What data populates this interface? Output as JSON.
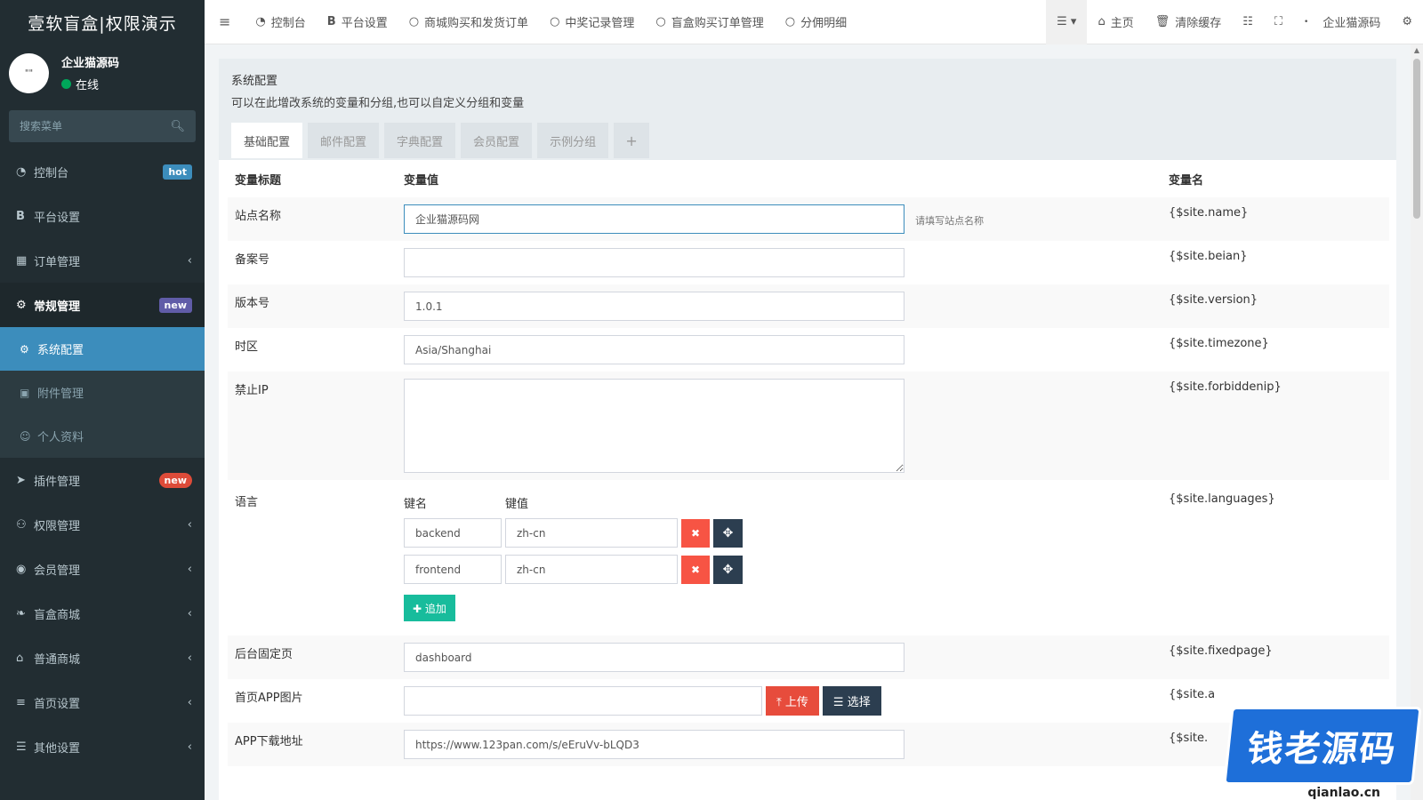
{
  "brand": "壹软盲盒|权限演示",
  "user": {
    "name": "企业猫源码",
    "status": "在线",
    "avatar_text": "\"\""
  },
  "sidebar": {
    "search_placeholder": "搜索菜单",
    "items": [
      {
        "label": "控制台",
        "badge": "hot"
      },
      {
        "label": "平台设置"
      },
      {
        "label": "订单管理"
      },
      {
        "label": "常规管理",
        "badge": "new"
      },
      {
        "label": "插件管理",
        "badge": "new"
      },
      {
        "label": "权限管理"
      },
      {
        "label": "会员管理"
      },
      {
        "label": "盲盒商城"
      },
      {
        "label": "普通商城"
      },
      {
        "label": "首页设置"
      },
      {
        "label": "其他设置"
      }
    ],
    "subitems": [
      {
        "label": "系统配置"
      },
      {
        "label": "附件管理"
      },
      {
        "label": "个人资料"
      }
    ]
  },
  "navbar": {
    "items": [
      {
        "label": "控制台"
      },
      {
        "label": "平台设置"
      },
      {
        "label": "商城购买和发货订单"
      },
      {
        "label": "中奖记录管理"
      },
      {
        "label": "盲盒购买订单管理"
      },
      {
        "label": "分佣明细"
      }
    ],
    "home": "主页",
    "clear_cache": "清除缓存",
    "user": "企业猫源码"
  },
  "panel": {
    "title": "系统配置",
    "desc": "可以在此增改系统的变量和分组,也可以自定义分组和变量",
    "tabs": [
      "基础配置",
      "邮件配置",
      "字典配置",
      "会员配置",
      "示例分组"
    ],
    "tab_add": "+"
  },
  "table": {
    "headers": {
      "title": "变量标题",
      "value": "变量值",
      "name": "变量名"
    },
    "rows": {
      "site_name": {
        "title": "站点名称",
        "value": "企业猫源码网",
        "hint": "请填写站点名称",
        "var": "{$site.name}"
      },
      "beian": {
        "title": "备案号",
        "value": "",
        "var": "{$site.beian}"
      },
      "version": {
        "title": "版本号",
        "value": "1.0.1",
        "var": "{$site.version}"
      },
      "timezone": {
        "title": "时区",
        "value": "Asia/Shanghai",
        "var": "{$site.timezone}"
      },
      "forbiddenip": {
        "title": "禁止IP",
        "value": "",
        "var": "{$site.forbiddenip}"
      },
      "languages": {
        "title": "语言",
        "var": "{$site.languages}",
        "key_header": "键名",
        "val_header": "键值",
        "pairs": [
          {
            "key": "backend",
            "value": "zh-cn"
          },
          {
            "key": "frontend",
            "value": "zh-cn"
          }
        ],
        "append_label": "追加"
      },
      "fixedpage": {
        "title": "后台固定页",
        "value": "dashboard",
        "var": "{$site.fixedpage}"
      },
      "app_image": {
        "title": "首页APP图片",
        "value": "",
        "upload_label": "上传",
        "choose_label": "选择",
        "var": "{$site.a"
      },
      "app_url": {
        "title": "APP下载地址",
        "value": "https://www.123pan.com/s/eEruVv-bLQD3",
        "var": "{$site."
      }
    }
  },
  "watermark": {
    "text": "钱老源码",
    "sub": "qianlao.cn"
  }
}
